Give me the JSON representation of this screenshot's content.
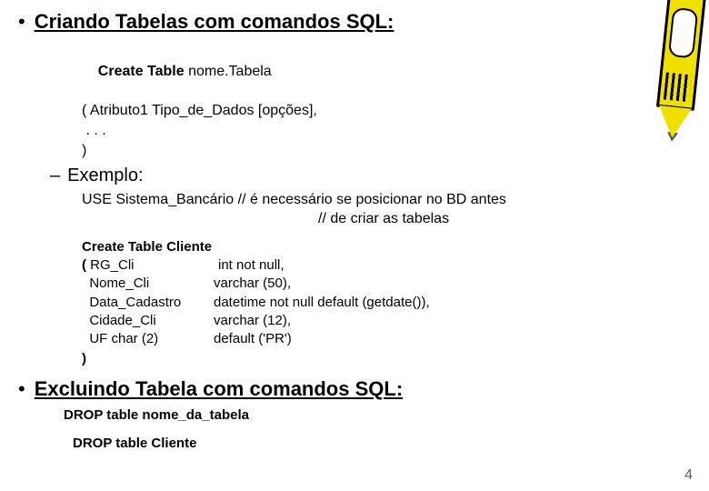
{
  "section1": {
    "title": "Criando Tabelas com comandos SQL:",
    "syntax": {
      "l1_bold": "Create Table",
      "l1_rest": " nome.Tabela",
      "l2": "( Atributo1 Tipo_de_Dados [opções],",
      "l3": " . . .",
      "l4": ")"
    },
    "example_label": "Exemplo:",
    "use_line": "USE Sistema_Bancário  // é necessário se posicionar no BD antes",
    "use_cont": "// de criar as tabelas",
    "code": {
      "head": "Create Table Cliente",
      "open": "(",
      "rows": [
        {
          "c1": " RG_Cli",
          "c2": "int not null,"
        },
        {
          "c1": "  Nome_Cli",
          "c2": "varchar (50),"
        },
        {
          "c1": "  Data_Cadastro",
          "c2": "datetime not null default (getdate()),"
        },
        {
          "c1": "  Cidade_Cli",
          "c2": "varchar (12),"
        },
        {
          "c1": "  UF char (2)",
          "c2": "default ('PR')"
        }
      ],
      "close": ")"
    }
  },
  "section2": {
    "title": "Excluindo Tabela com comandos SQL:",
    "drop_syntax": "DROP table nome_da_tabela",
    "drop_example": "DROP table Cliente"
  },
  "page_number": "4",
  "icons": {
    "crayon": "crayon-icon"
  }
}
